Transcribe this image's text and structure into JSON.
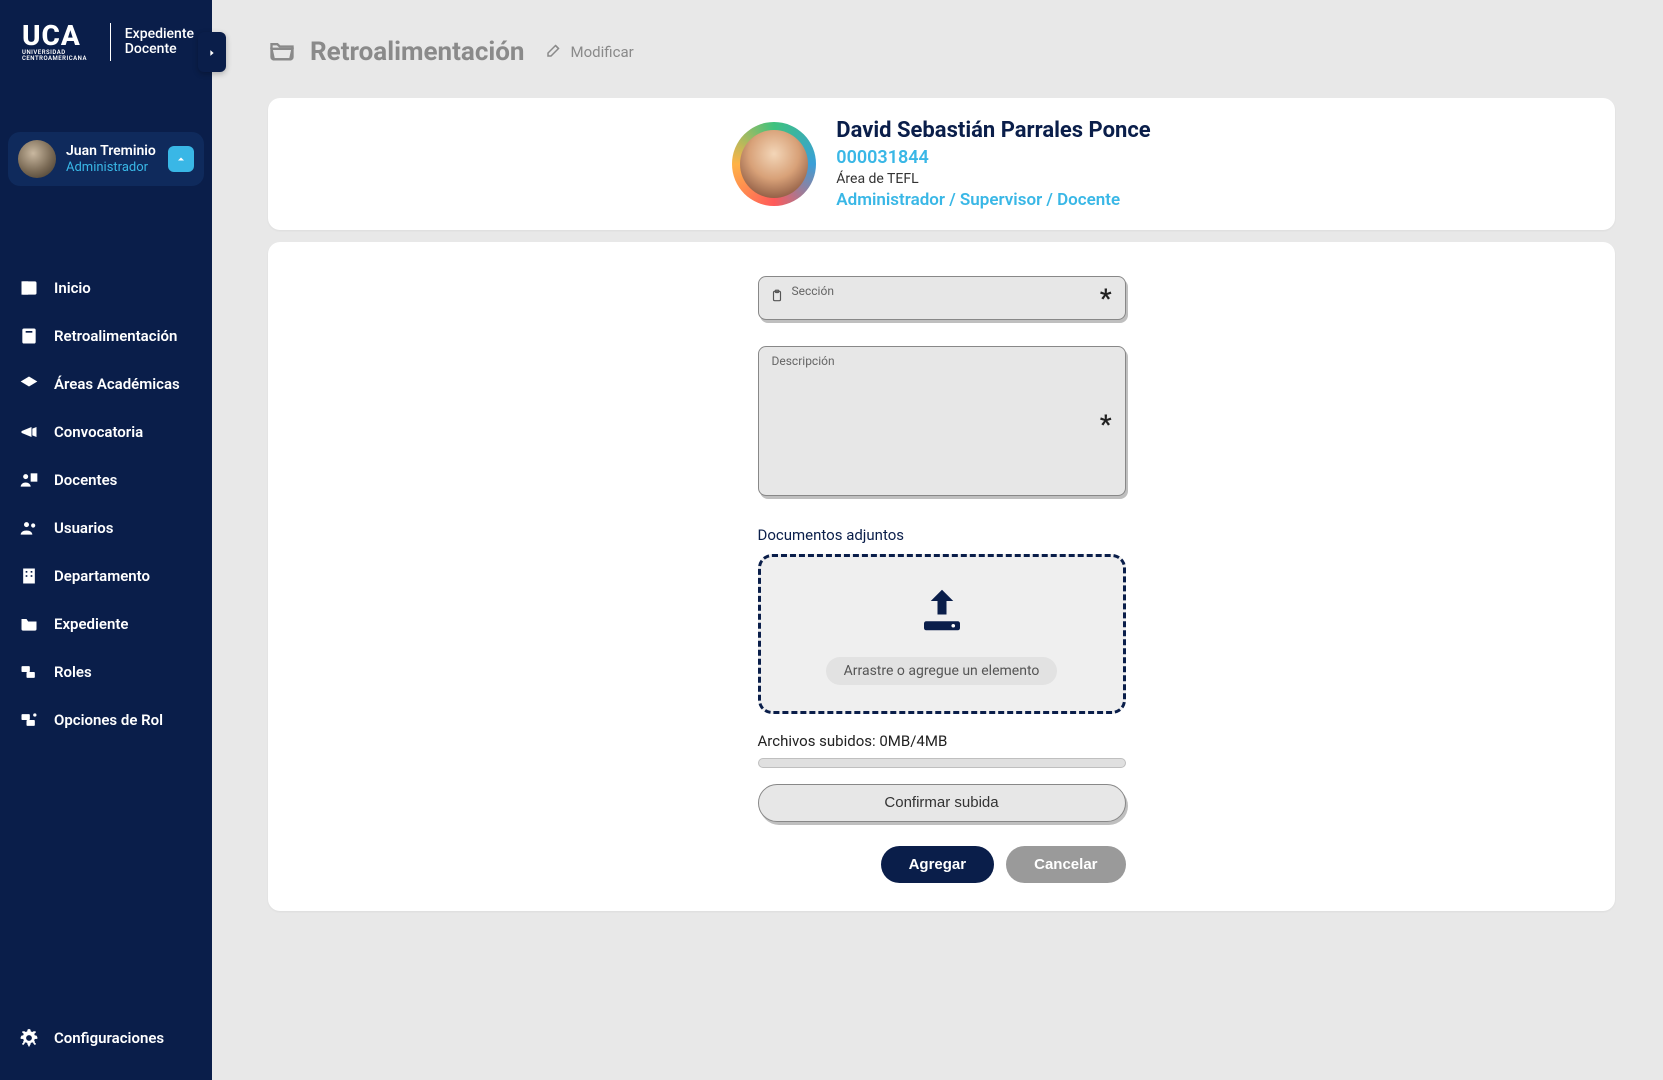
{
  "brand": {
    "name": "UCA",
    "subtitle": "UNIVERSIDAD CENTROAMERICANA",
    "product_line1": "Expediente",
    "product_line2": "Docente"
  },
  "user": {
    "name": "Juan Treminio",
    "role": "Administrador"
  },
  "nav": {
    "items": [
      {
        "label": "Inicio",
        "icon": "home"
      },
      {
        "label": "Retroalimentación",
        "icon": "book"
      },
      {
        "label": "Áreas Académicas",
        "icon": "gradcap"
      },
      {
        "label": "Convocatoria",
        "icon": "megaphone"
      },
      {
        "label": "Docentes",
        "icon": "teacher"
      },
      {
        "label": "Usuarios",
        "icon": "users"
      },
      {
        "label": "Departamento",
        "icon": "building"
      },
      {
        "label": "Expediente",
        "icon": "folder"
      },
      {
        "label": "Roles",
        "icon": "roles"
      },
      {
        "label": "Opciones de Rol",
        "icon": "roleopts"
      }
    ],
    "bottom": {
      "label": "Configuraciones",
      "icon": "gear"
    }
  },
  "page": {
    "title": "Retroalimentación",
    "action": "Modificar"
  },
  "profile": {
    "name": "David Sebastián Parrales Ponce",
    "id": "000031844",
    "area": "Área de TEFL",
    "roles": "Administrador / Supervisor / Docente"
  },
  "form": {
    "section_label": "Sección",
    "section_value": "",
    "description_label": "Descripción",
    "description_value": "",
    "attachments_label": "Documentos adjuntos",
    "dropzone_text": "Arrastre o agregue un elemento",
    "upload_status": "Archivos subidos: 0MB/4MB",
    "confirm_label": "Confirmar subida",
    "add_label": "Agregar",
    "cancel_label": "Cancelar"
  },
  "colors": {
    "sidebar_bg": "#0a1e4a",
    "accent": "#39b7e6",
    "page_bg": "#e8e8e8"
  }
}
